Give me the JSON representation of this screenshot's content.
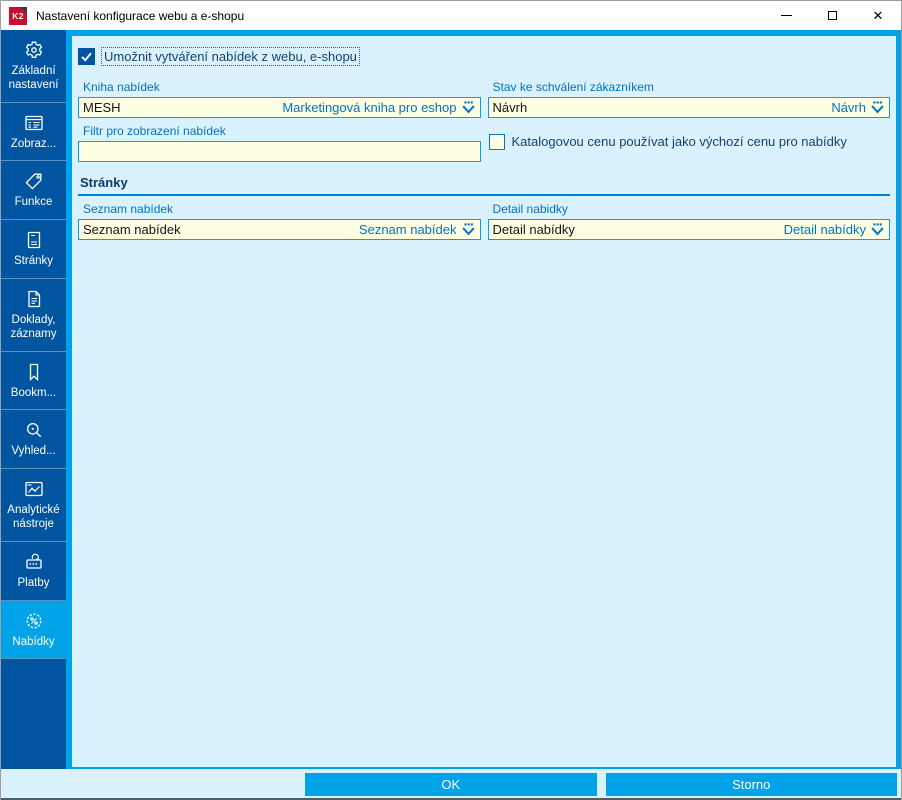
{
  "window": {
    "title": "Nastavení konfigurace webu a e-shopu",
    "logo_text": "K2",
    "controls": {
      "minimize": "minimize-icon",
      "maximize": "maximize-icon",
      "close": "close-icon"
    }
  },
  "colors": {
    "sidebar_bg": "#0054a0",
    "sidebar_selected": "#00a3e8",
    "content_bg": "#daf2fe",
    "frame_accent": "#00a3e8",
    "field_bg": "#ffffe3",
    "label_blue": "#0072c6",
    "dark_navy_text": "#16416e",
    "button_bg": "#00a3e8"
  },
  "sidebar": {
    "items": [
      {
        "id": "zakladni-nastaveni",
        "label": "Základní nastavení",
        "icon": "gear-icon",
        "selected": false
      },
      {
        "id": "zobrazeni",
        "label": "Zobraz...",
        "icon": "display-panel-icon",
        "selected": false
      },
      {
        "id": "funkce",
        "label": "Funkce",
        "icon": "tag-icon",
        "selected": false
      },
      {
        "id": "stranky",
        "label": "Stránky",
        "icon": "pages-icon",
        "selected": false
      },
      {
        "id": "doklady-zaznamy",
        "label": "Doklady, záznamy",
        "icon": "document-icon",
        "selected": false
      },
      {
        "id": "bookmarky",
        "label": "Bookm...",
        "icon": "bookmark-icon",
        "selected": false
      },
      {
        "id": "vyhledavani",
        "label": "Vyhled...",
        "icon": "search-icon",
        "selected": false
      },
      {
        "id": "analyticke-nastroje",
        "label": "Analytické nástroje",
        "icon": "analytics-icon",
        "selected": false
      },
      {
        "id": "platby",
        "label": "Platby",
        "icon": "payments-icon",
        "selected": false
      },
      {
        "id": "nabidky",
        "label": "Nabídky",
        "icon": "offer-badge-icon",
        "selected": true
      }
    ]
  },
  "form": {
    "enable_offers_checkbox": {
      "label": "Umožnit vytváření nabídek z webu, e-shopu",
      "checked": true
    },
    "kniha_nabidek": {
      "label": "Kniha nabídek",
      "value": "MESH",
      "display": "Marketingová kniha pro eshop"
    },
    "stav_schvaleni": {
      "label": "Stav ke schválení zákazníkem",
      "value": "Návrh",
      "display": "Návrh"
    },
    "filtr": {
      "label": "Filtr pro zobrazení nabídek",
      "value": ""
    },
    "katalog_checkbox": {
      "label": "Katalogovou cenu používat jako výchozí cenu pro nabídky",
      "checked": false
    },
    "stranky_section": {
      "title": "Stránky"
    },
    "seznam_nabidek": {
      "label": "Seznam nabídek",
      "value": "Seznam nabídek",
      "display": "Seznam nabídek"
    },
    "detail_nabidky": {
      "label": "Detail nabidky",
      "value": "Detail nabídky",
      "display": "Detail nabídky"
    }
  },
  "footer": {
    "ok_label": "OK",
    "cancel_label": "Storno"
  }
}
